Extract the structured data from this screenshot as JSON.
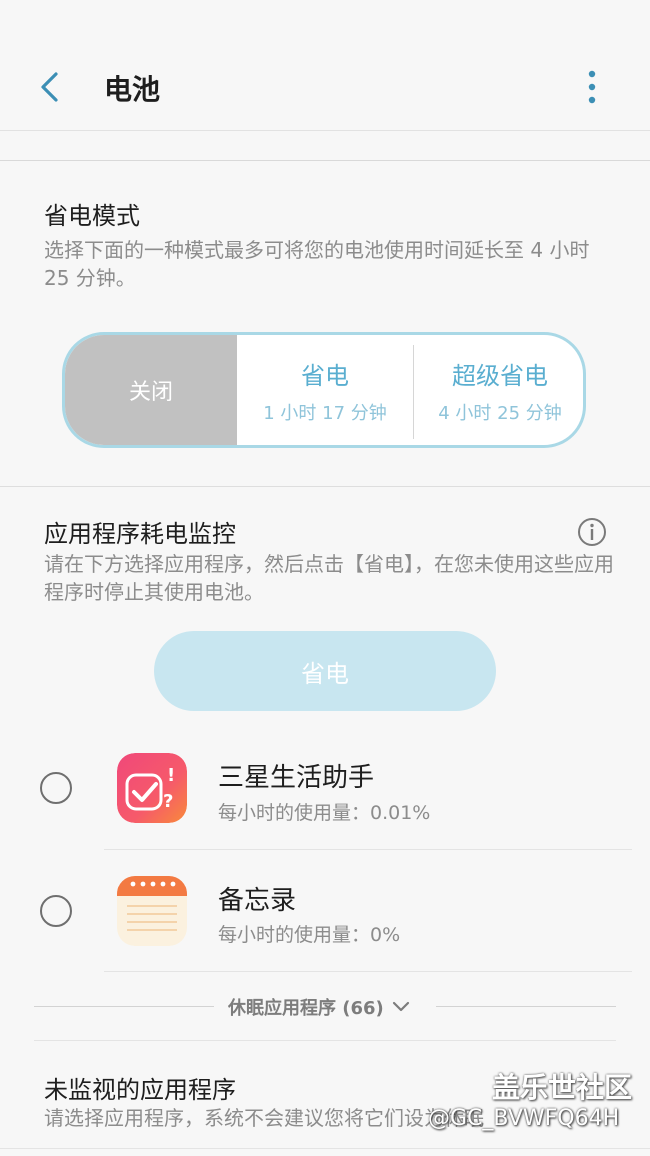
{
  "header": {
    "title": "电池"
  },
  "power_mode": {
    "title": "省电模式",
    "description": "选择下面的一种模式最多可将您的电池使用时间延长至 4 小时 25 分钟。",
    "options": [
      {
        "name": "关闭"
      },
      {
        "name": "省电",
        "time": "1 小时 17 分钟"
      },
      {
        "name": "超级省电",
        "time": "4 小时 25 分钟"
      }
    ],
    "selected": "关闭"
  },
  "app_monitor": {
    "title": "应用程序耗电监控",
    "description": "请在下方选择应用程序，然后点击【省电】，在您未使用这些应用程序时停止其使用电池。",
    "save_button": "省电",
    "apps": [
      {
        "name": "三星生活助手",
        "usage": "每小时的使用量：0.01%",
        "icon": "samsung-life-assistant-icon",
        "checked": false
      },
      {
        "name": "备忘录",
        "usage": "每小时的使用量：0%",
        "icon": "memo-icon",
        "checked": false
      }
    ],
    "sleeping_apps": "休眠应用程序 (66)"
  },
  "unmonitored": {
    "title": "未监视的应用程序",
    "description": "请选择应用程序，系统不会建议您将它们设为休眠"
  },
  "watermark": {
    "line1": "盖乐世社区",
    "line2": "@GC_BVWFQ64H"
  },
  "colors": {
    "accent": "#5aaed0",
    "off_gray": "#c1c1c1",
    "button_disabled": "#c8e6f0"
  }
}
